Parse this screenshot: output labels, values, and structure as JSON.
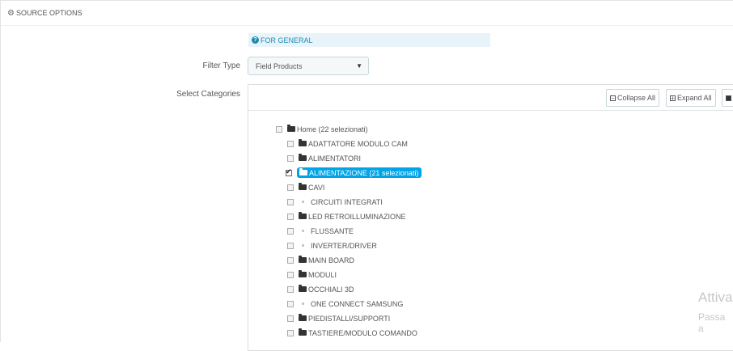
{
  "panel": {
    "title": "SOURCE OPTIONS"
  },
  "info": {
    "text": "FOR GENERAL"
  },
  "filter": {
    "label": "Filter Type",
    "selected": "Field Products"
  },
  "categories": {
    "label": "Select Categories",
    "collapse_label": "Collapse All",
    "expand_label": "Expand All",
    "root": {
      "label": "Home (22 selezionati)",
      "checked": false
    },
    "items": [
      {
        "label": "ADATTATORE MODULO CAM",
        "type": "folder",
        "checked": false,
        "selected": false
      },
      {
        "label": "ALIMENTATORI",
        "type": "folder",
        "checked": false,
        "selected": false
      },
      {
        "label": "ALIMENTAZIONE (21 selezionati)",
        "type": "folder",
        "checked": true,
        "selected": true
      },
      {
        "label": "CAVI",
        "type": "folder",
        "checked": false,
        "selected": false
      },
      {
        "label": "CIRCUITI INTEGRATI",
        "type": "leaf",
        "checked": false,
        "selected": false
      },
      {
        "label": "LED RETROILLUMINAZIONE",
        "type": "folder",
        "checked": false,
        "selected": false
      },
      {
        "label": "FLUSSANTE",
        "type": "leaf",
        "checked": false,
        "selected": false
      },
      {
        "label": "INVERTER/DRIVER",
        "type": "leaf",
        "checked": false,
        "selected": false
      },
      {
        "label": "MAIN BOARD",
        "type": "folder",
        "checked": false,
        "selected": false
      },
      {
        "label": "MODULI",
        "type": "folder",
        "checked": false,
        "selected": false
      },
      {
        "label": "OCCHIALI 3D",
        "type": "folder",
        "checked": false,
        "selected": false
      },
      {
        "label": "ONE CONNECT SAMSUNG",
        "type": "leaf",
        "checked": false,
        "selected": false
      },
      {
        "label": "PIEDISTALLI/SUPPORTI",
        "type": "folder",
        "checked": false,
        "selected": false
      },
      {
        "label": "TASTIERE/MODULO COMANDO",
        "type": "folder",
        "checked": false,
        "selected": false
      }
    ]
  },
  "watermark": {
    "line1": "Attiva",
    "line2": "Passa a"
  },
  "colors": {
    "accent": "#00a4e7",
    "info_bg": "#e8f4fa",
    "info_text": "#1f8ab3"
  }
}
